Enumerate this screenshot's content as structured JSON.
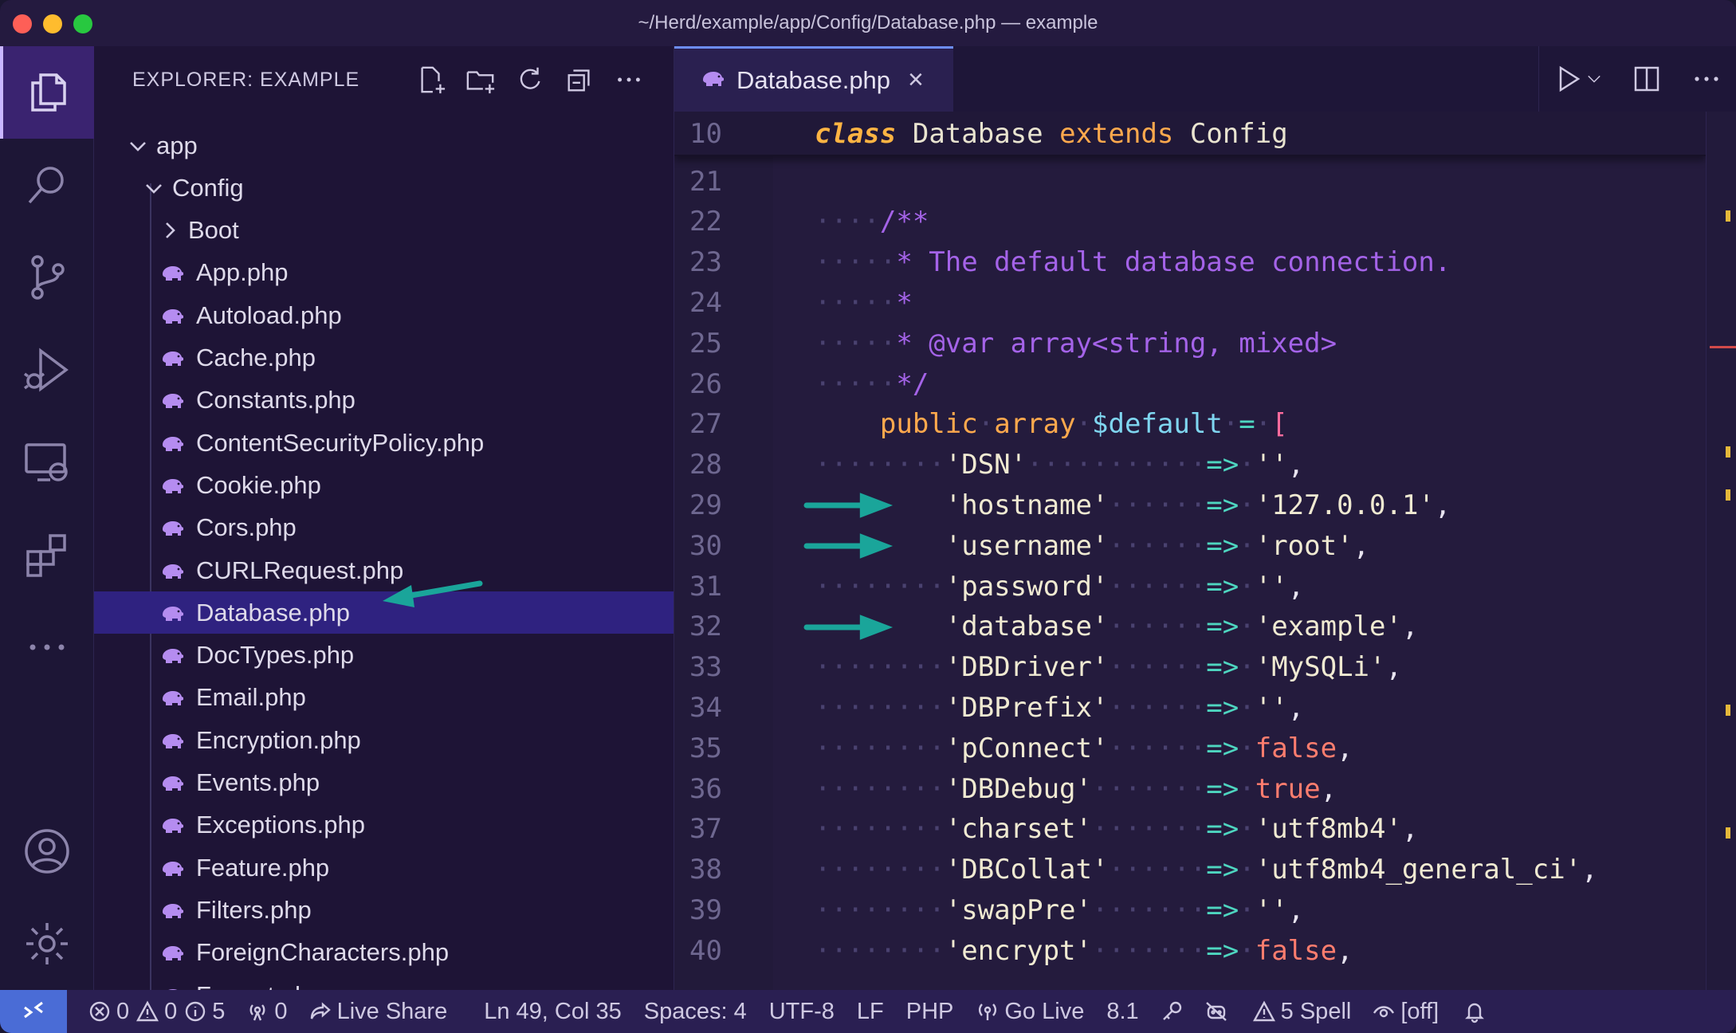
{
  "window": {
    "title": "~/Herd/example/app/Config/Database.php — example"
  },
  "sidebar": {
    "header": "EXPLORER: EXAMPLE",
    "tree": [
      {
        "label": "app",
        "kind": "folder-open",
        "depth": 0
      },
      {
        "label": "Config",
        "kind": "folder-open",
        "depth": 1
      },
      {
        "label": "Boot",
        "kind": "folder-closed",
        "depth": 2
      },
      {
        "label": "App.php",
        "kind": "file",
        "depth": 2
      },
      {
        "label": "Autoload.php",
        "kind": "file",
        "depth": 2
      },
      {
        "label": "Cache.php",
        "kind": "file",
        "depth": 2
      },
      {
        "label": "Constants.php",
        "kind": "file",
        "depth": 2
      },
      {
        "label": "ContentSecurityPolicy.php",
        "kind": "file",
        "depth": 2
      },
      {
        "label": "Cookie.php",
        "kind": "file",
        "depth": 2
      },
      {
        "label": "Cors.php",
        "kind": "file",
        "depth": 2
      },
      {
        "label": "CURLRequest.php",
        "kind": "file",
        "depth": 2
      },
      {
        "label": "Database.php",
        "kind": "file",
        "depth": 2,
        "selected": true
      },
      {
        "label": "DocTypes.php",
        "kind": "file",
        "depth": 2
      },
      {
        "label": "Email.php",
        "kind": "file",
        "depth": 2
      },
      {
        "label": "Encryption.php",
        "kind": "file",
        "depth": 2
      },
      {
        "label": "Events.php",
        "kind": "file",
        "depth": 2
      },
      {
        "label": "Exceptions.php",
        "kind": "file",
        "depth": 2
      },
      {
        "label": "Feature.php",
        "kind": "file",
        "depth": 2
      },
      {
        "label": "Filters.php",
        "kind": "file",
        "depth": 2
      },
      {
        "label": "ForeignCharacters.php",
        "kind": "file",
        "depth": 2
      },
      {
        "label": "Format.php",
        "kind": "file",
        "depth": 2
      }
    ]
  },
  "editor": {
    "tab_label": "Database.php",
    "sticky": {
      "ln": "10",
      "kw": "class",
      "name": "Database",
      "ext": "extends",
      "base": "Config"
    },
    "lines": [
      {
        "ln": "21"
      },
      {
        "ln": "22",
        "comment": "/**"
      },
      {
        "ln": "23",
        "comment": "* The default database connection."
      },
      {
        "ln": "24",
        "comment": "*"
      },
      {
        "ln": "25",
        "comment": "* @var array<string, mixed>"
      },
      {
        "ln": "26",
        "comment": "*/"
      },
      {
        "ln": "27",
        "decl": {
          "kw1": "public",
          "kw2": "array",
          "var": "$default",
          "op": "=",
          "br": "["
        }
      },
      {
        "ln": "28",
        "key": "'DSN'",
        "val": "''",
        "vtype": "str"
      },
      {
        "ln": "29",
        "key": "'hostname'",
        "val": "'127.0.0.1'",
        "vtype": "str",
        "arrow": true
      },
      {
        "ln": "30",
        "key": "'username'",
        "val": "'root'",
        "vtype": "str",
        "arrow": true
      },
      {
        "ln": "31",
        "key": "'password'",
        "val": "''",
        "vtype": "str"
      },
      {
        "ln": "32",
        "key": "'database'",
        "val": "'example'",
        "vtype": "str",
        "arrow": true
      },
      {
        "ln": "33",
        "key": "'DBDriver'",
        "val": "'MySQLi'",
        "vtype": "str"
      },
      {
        "ln": "34",
        "key": "'DBPrefix'",
        "val": "''",
        "vtype": "str"
      },
      {
        "ln": "35",
        "key": "'pConnect'",
        "val": "false",
        "vtype": "bool"
      },
      {
        "ln": "36",
        "key": "'DBDebug'",
        "val": "true",
        "vtype": "bool"
      },
      {
        "ln": "37",
        "key": "'charset'",
        "val": "'utf8mb4'",
        "vtype": "str"
      },
      {
        "ln": "38",
        "key": "'DBCollat'",
        "val": "'utf8mb4_general_ci'",
        "vtype": "str"
      },
      {
        "ln": "39",
        "key": "'swapPre'",
        "val": "''",
        "vtype": "str"
      },
      {
        "ln": "40",
        "key": "'encrypt'",
        "val": "false",
        "vtype": "bool"
      }
    ],
    "arrow_symbol": "=>"
  },
  "status": {
    "errors": "0",
    "warnings": "0",
    "infos": "5",
    "ports": "0",
    "live_share": "Live Share",
    "position": "Ln 49, Col 35",
    "spaces": "Spaces: 4",
    "encoding": "UTF-8",
    "eol": "LF",
    "language": "PHP",
    "go_live": "Go Live",
    "php_version": "8.1",
    "spell": "5 Spell",
    "off": "[off]"
  },
  "colors": {
    "accent": "#6d8df5",
    "selection": "#2f2280",
    "arrow": "#1aa59a",
    "php_icon": "#b58cf0"
  }
}
